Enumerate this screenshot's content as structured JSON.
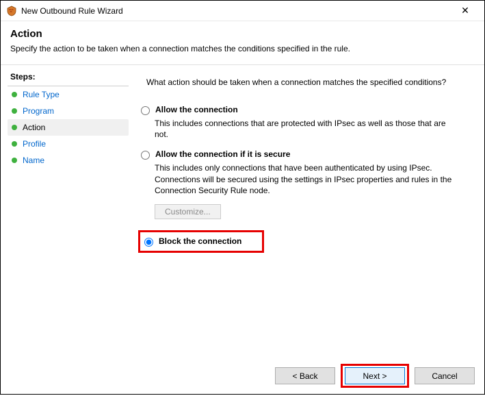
{
  "window": {
    "title": "New Outbound Rule Wizard"
  },
  "header": {
    "heading": "Action",
    "subtext": "Specify the action to be taken when a connection matches the conditions specified in the rule."
  },
  "sidebar": {
    "label": "Steps:",
    "items": [
      {
        "label": "Rule Type",
        "state": "link"
      },
      {
        "label": "Program",
        "state": "link"
      },
      {
        "label": "Action",
        "state": "current"
      },
      {
        "label": "Profile",
        "state": "link"
      },
      {
        "label": "Name",
        "state": "link"
      }
    ]
  },
  "content": {
    "prompt": "What action should be taken when a connection matches the specified conditions?",
    "options": {
      "allow": {
        "label": "Allow the connection",
        "desc": "This includes connections that are protected with IPsec as well as those that are not."
      },
      "allow_secure": {
        "label": "Allow the connection if it is secure",
        "desc": "This includes only connections that have been authenticated by using IPsec.  Connections will be secured using the settings in IPsec properties and rules in the Connection Security Rule node.",
        "customize": "Customize..."
      },
      "block": {
        "label": "Block the connection"
      }
    },
    "selected": "block"
  },
  "buttons": {
    "back": "< Back",
    "next": "Next >",
    "cancel": "Cancel"
  }
}
